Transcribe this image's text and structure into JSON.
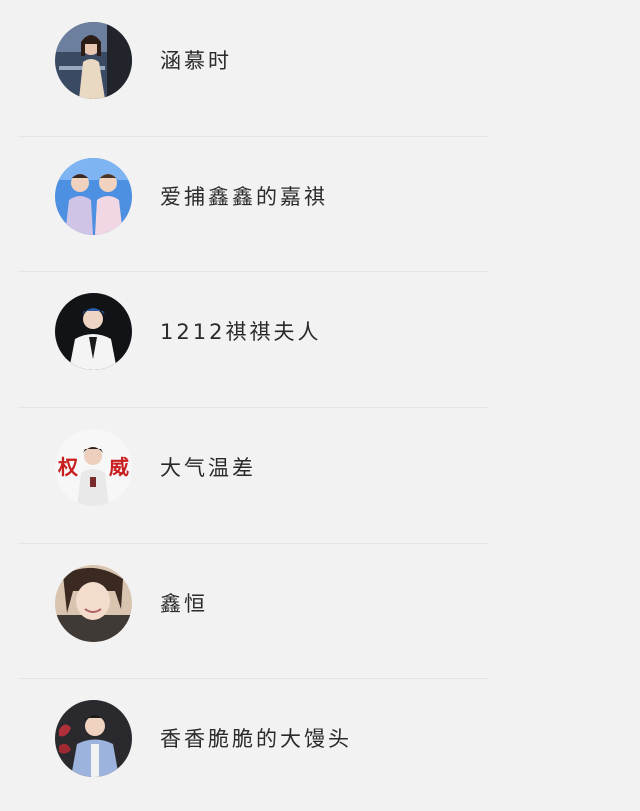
{
  "contacts": [
    {
      "name": "涵慕时",
      "avatar": "avatar-photo-woman-window"
    },
    {
      "name": "爱捕鑫鑫的嘉祺",
      "avatar": "avatar-photo-two-performers"
    },
    {
      "name": "1212祺祺夫人",
      "avatar": "avatar-photo-man-white-suit"
    },
    {
      "name": "大气温差",
      "avatar": "avatar-photo-boy-red-characters"
    },
    {
      "name": "鑫恒",
      "avatar": "avatar-photo-smiling-girl"
    },
    {
      "name": "香香脆脆的大馒头",
      "avatar": "avatar-photo-man-blue-jacket"
    }
  ],
  "avatar_text": {
    "left": "权",
    "right": "威"
  }
}
